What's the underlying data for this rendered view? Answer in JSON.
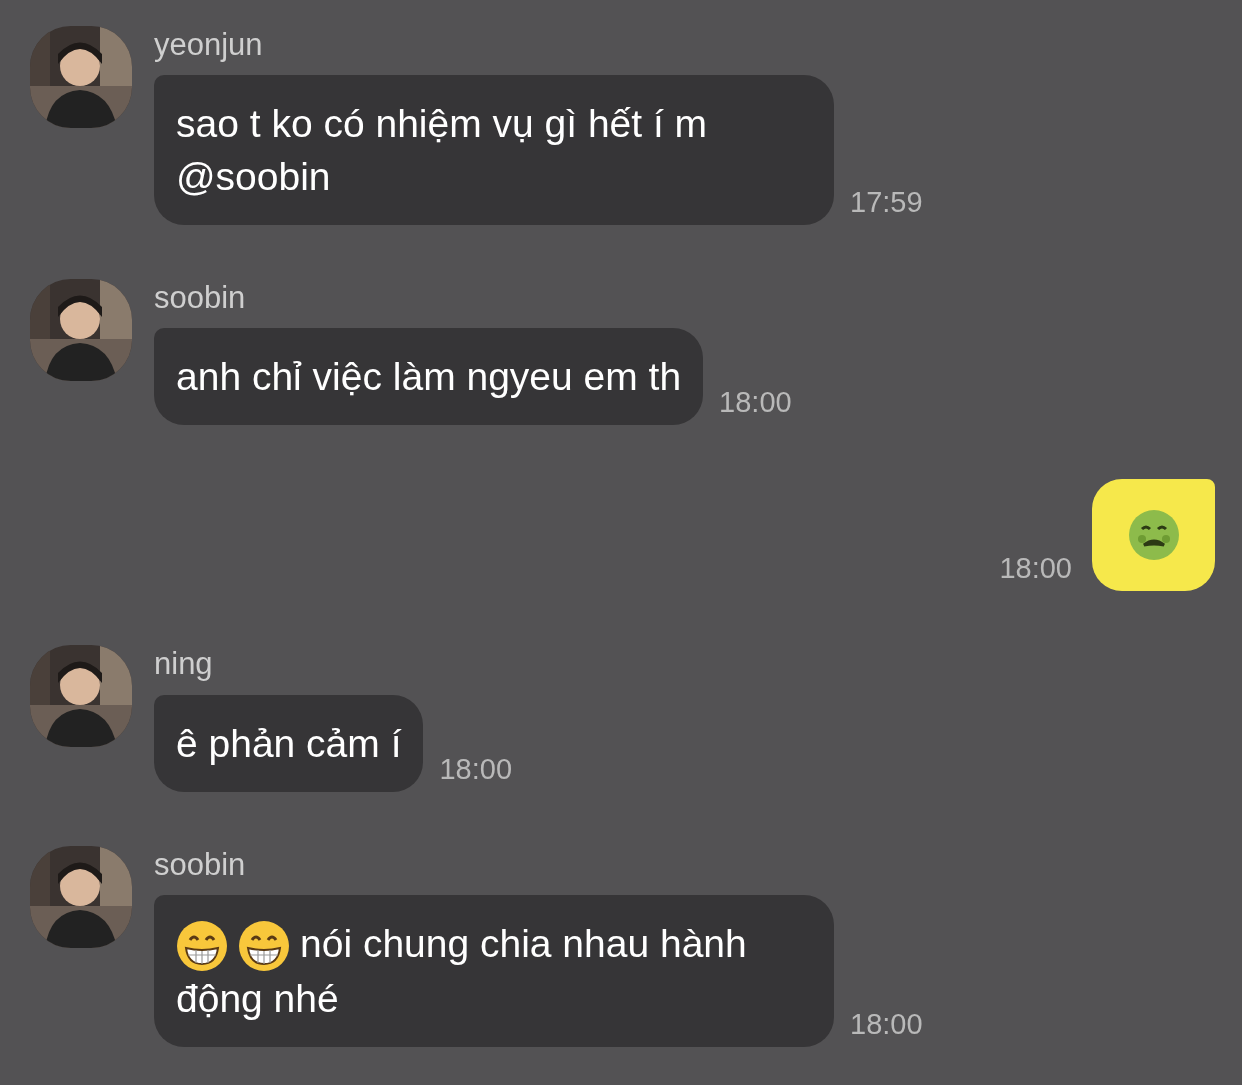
{
  "messages": [
    {
      "kind": "incoming",
      "sender": "yeonjun",
      "parts": [
        {
          "kind": "text",
          "text": "sao t ko có nhiệm vụ gì hết í m @soobin"
        }
      ],
      "time": "17:59"
    },
    {
      "kind": "incoming",
      "sender": "soobin",
      "parts": [
        {
          "kind": "text",
          "text": "anh chỉ việc làm ngyeu em th"
        }
      ],
      "time": "18:00"
    },
    {
      "kind": "outgoing",
      "parts": [
        {
          "kind": "sick-emoji"
        }
      ],
      "time": "18:00"
    },
    {
      "kind": "incoming",
      "sender": "ning",
      "parts": [
        {
          "kind": "text",
          "text": "ê phản cảm í"
        }
      ],
      "time": "18:00"
    },
    {
      "kind": "incoming",
      "sender": "soobin",
      "parts": [
        {
          "kind": "grin-emoji"
        },
        {
          "kind": "grin-emoji"
        },
        {
          "kind": "text",
          "text": "nói chung chia nhau hành động nhé"
        }
      ],
      "time": "18:00"
    }
  ]
}
